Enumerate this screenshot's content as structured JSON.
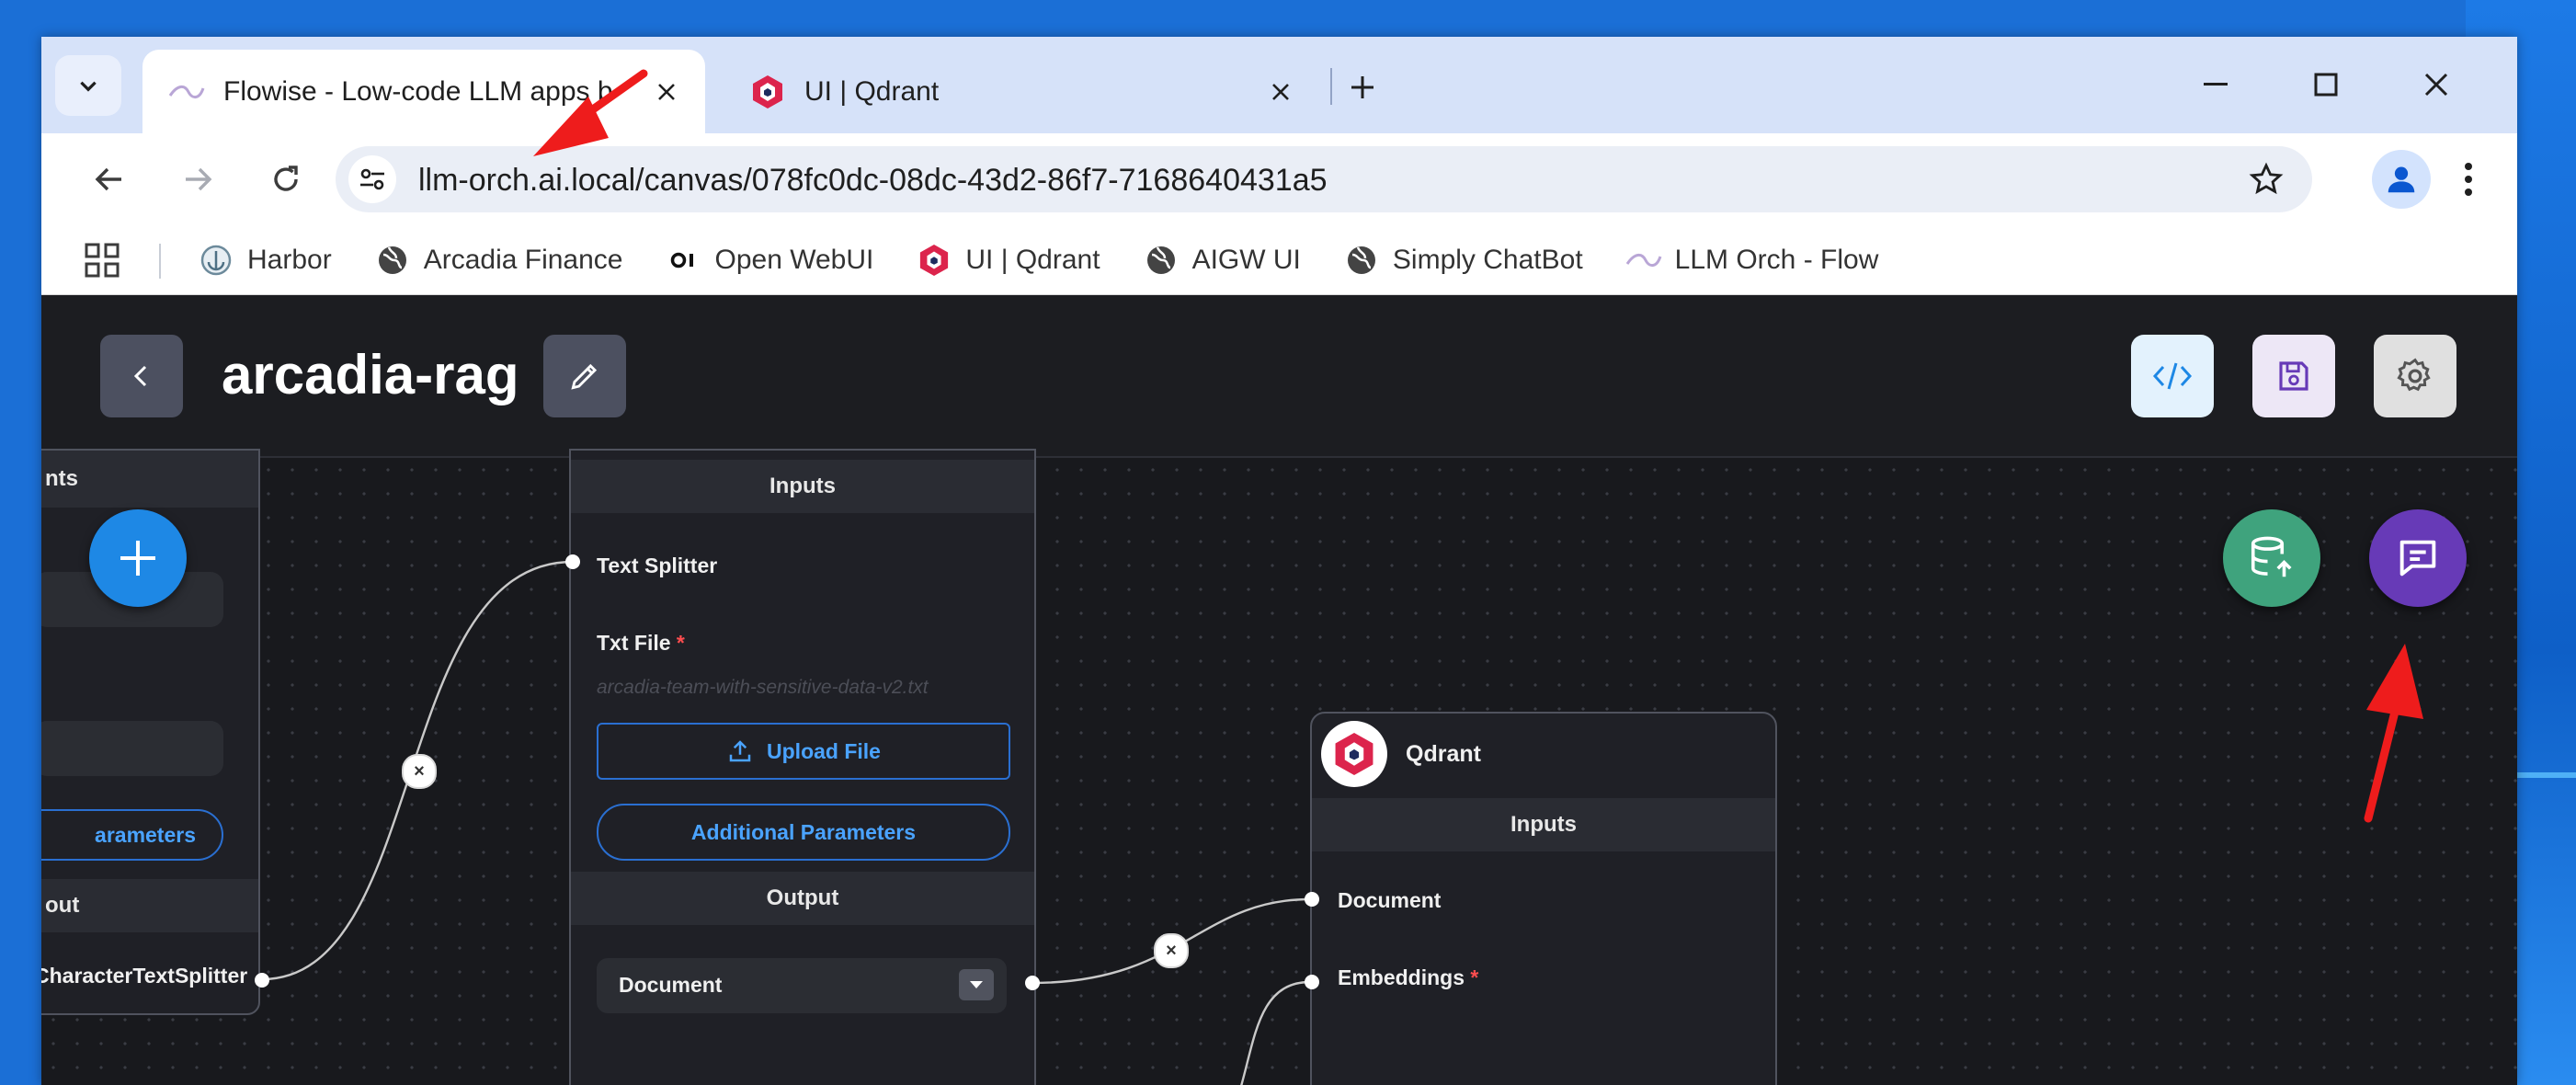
{
  "browser": {
    "tabs": [
      {
        "title": "Flowise - Low-code LLM apps b",
        "favicon": "flowise-wave-icon",
        "active": true
      },
      {
        "title": "UI | Qdrant",
        "favicon": "qdrant-icon",
        "active": false
      }
    ],
    "url": "llm-orch.ai.local/canvas/078fc0dc-08dc-43d2-86f7-7168640431a5",
    "bookmarks": [
      {
        "label": "Harbor",
        "icon": "harbor-icon"
      },
      {
        "label": "Arcadia Finance",
        "icon": "globe-icon"
      },
      {
        "label": "Open WebUI",
        "icon": "openwebui-icon"
      },
      {
        "label": "UI | Qdrant",
        "icon": "qdrant-icon"
      },
      {
        "label": "AIGW UI",
        "icon": "globe-icon"
      },
      {
        "label": "Simply ChatBot",
        "icon": "globe-icon"
      },
      {
        "label": "LLM Orch - Flow",
        "icon": "flowise-wave-icon"
      }
    ]
  },
  "app": {
    "flow_title": "arcadia-rag",
    "colors": {
      "accent_blue": "#1e88e5",
      "fab_green": "#3fa37d",
      "fab_purple": "#673ab7",
      "code_btn_bg": "#e3f2fd",
      "save_btn_bg": "#ede7f6",
      "settings_btn_bg": "#e0e0e0"
    }
  },
  "nodes": {
    "left": {
      "section_top": "nts",
      "additional_params": "arameters",
      "output_section": "out",
      "output_label": "CharacterTextSplitter"
    },
    "text_file": {
      "inputs_header": "Inputs",
      "text_splitter_label": "Text Splitter",
      "txt_file_label": "Txt File",
      "required_mark": "*",
      "file_placeholder": "arcadia-team-with-sensitive-data-v2.txt",
      "upload_label": "Upload File",
      "additional_params": "Additional Parameters",
      "output_header": "Output",
      "output_value": "Document"
    },
    "qdrant": {
      "title": "Qdrant",
      "inputs_header": "Inputs",
      "document_label": "Document",
      "embeddings_label": "Embeddings",
      "required_mark": "*"
    }
  }
}
